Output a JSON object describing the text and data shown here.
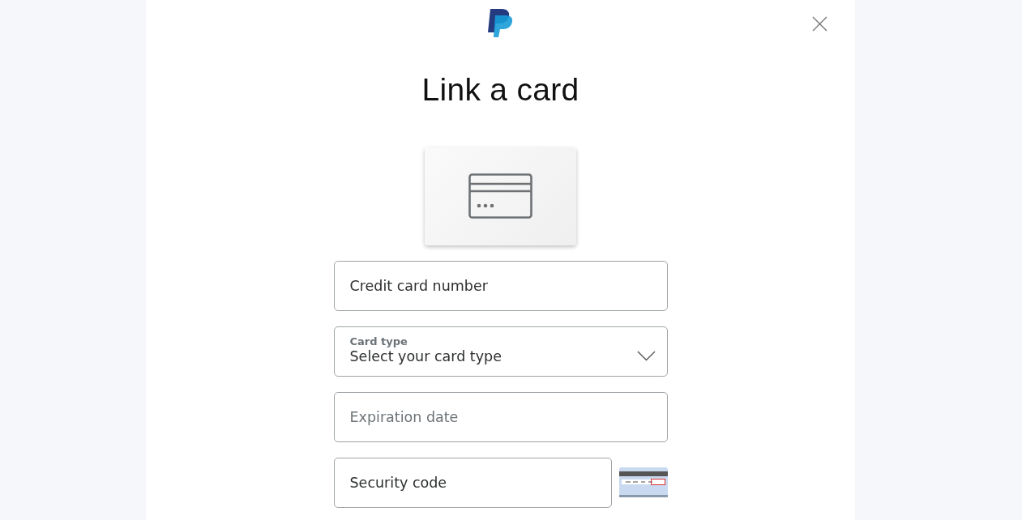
{
  "title": "Link a card",
  "fields": [
    {
      "kind": "input",
      "placeholder": "Credit card number"
    },
    {
      "kind": "select",
      "label": "Card type",
      "value": "Select your card type"
    },
    {
      "kind": "input",
      "placeholder": "Expiration date"
    },
    {
      "kind": "input",
      "placeholder": "Security code",
      "hint_image": true
    }
  ]
}
